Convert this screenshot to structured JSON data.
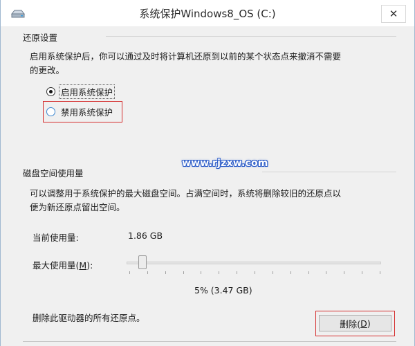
{
  "window": {
    "title": "系统保护Windows8_OS (C:)",
    "close_glyph": "✕"
  },
  "restore_settings": {
    "header": "还原设置",
    "description_line1": "启用系统保护后，你可以通过及时将计算机还原到以前的某个状态点来撤消不需要",
    "description_line2": "的更改。",
    "options": [
      {
        "label": "启用系统保护",
        "selected": true
      },
      {
        "label": "禁用系统保护",
        "selected": false
      }
    ]
  },
  "watermark": "www.rjzxw.com",
  "disk_usage": {
    "header": "磁盘空间使用量",
    "description_line1": "可以调整用于系统保护的最大磁盘空间。占满空间时，系统将删除较旧的还原点以",
    "description_line2": "便为新还原点留出空间。",
    "current_label": "当前使用量:",
    "current_value": "1.86 GB",
    "max_label_prefix": "最大使用量(",
    "max_label_key": "M",
    "max_label_suffix": "):",
    "slider_fraction": 0.05,
    "percent_text": "5% (3.47 GB)",
    "delete_text": "删除此驱动器的所有还原点。",
    "delete_button_prefix": "删除(",
    "delete_button_key": "D",
    "delete_button_suffix": ")"
  },
  "colors": {
    "highlight_box": "#d42a2a",
    "watermark_outline": "#2a5bc8"
  },
  "icons": {
    "app": "drive-icon",
    "close": "close-icon"
  }
}
